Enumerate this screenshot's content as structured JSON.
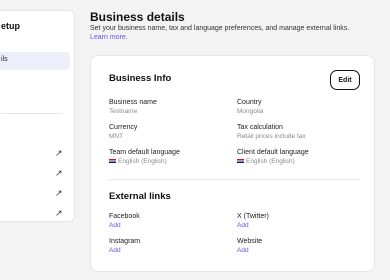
{
  "sidebar": {
    "title": "etup",
    "active_item": "ils",
    "arrow_glyph": "↗",
    "arrow_icon": "external-link-icon"
  },
  "header": {
    "title": "Business details",
    "description": "Set your business name, tax and language preferences, and manage external links.",
    "learn_more": "Learn more."
  },
  "business_info": {
    "title": "Business Info",
    "edit_label": "Edit",
    "fields": {
      "business_name": {
        "label": "Business name",
        "value": "Testname"
      },
      "country": {
        "label": "Country",
        "value": "Mongolia"
      },
      "currency": {
        "label": "Currency",
        "value": "MNT"
      },
      "tax_calculation": {
        "label": "Tax calculation",
        "value": "Retail prices include tax"
      },
      "team_language": {
        "label": "Team default language",
        "value": "English (English)",
        "flag_icon": "uk-flag-icon"
      },
      "client_language": {
        "label": "Client default language",
        "value": "English (English)",
        "flag_icon": "uk-flag-icon"
      }
    }
  },
  "external_links": {
    "title": "External links",
    "links": {
      "facebook": {
        "label": "Facebook",
        "action": "Add"
      },
      "twitter": {
        "label": "X (Twitter)",
        "action": "Add"
      },
      "instagram": {
        "label": "Instagram",
        "action": "Add"
      },
      "website": {
        "label": "Website",
        "action": "Add"
      }
    }
  },
  "colors": {
    "accent": "#6c4ee6",
    "background": "#f3f3f4",
    "active_item_bg": "#eeeefb"
  }
}
